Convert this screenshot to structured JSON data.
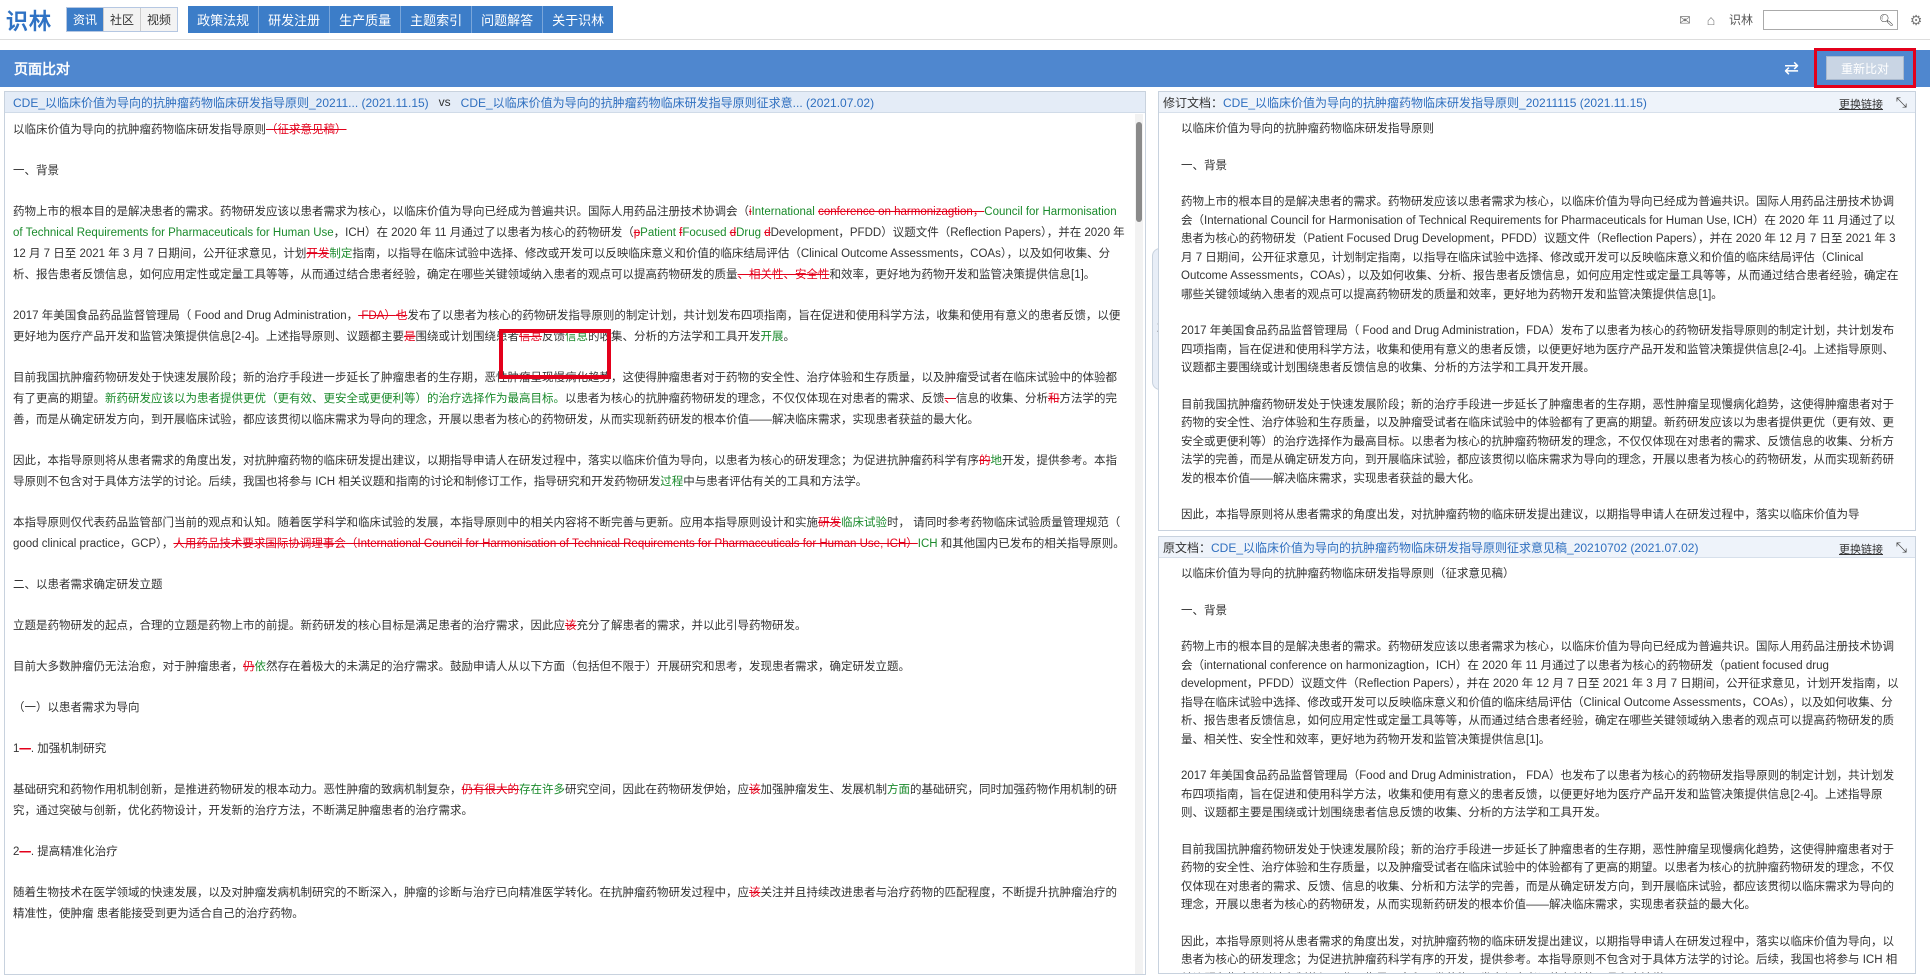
{
  "app": {
    "logo": "识林",
    "segments": [
      "资讯",
      "社区",
      "视频"
    ],
    "nav": [
      "政策法规",
      "研发注册",
      "生产质量",
      "主题索引",
      "问题解答",
      "关于识林"
    ],
    "icons": [
      "mail-icon",
      "home-icon",
      "settings-icon"
    ],
    "user_label": "识林",
    "search_placeholder": ""
  },
  "titlebar": {
    "title": "页面比对",
    "redo_label": "重新比对"
  },
  "left": {
    "header_a": "CDE_以临床价值为导向的抗肿瘤药物临床研发指导原则_20211... (2021.11.15)",
    "vs": "vs",
    "header_b": "CDE_以临床价值为导向的抗肿瘤药物临床研发指导原则征求意... (2021.07.02)",
    "p1": "以临床价值为导向的抗肿瘤药物临床研发指导原则",
    "p1_del": "（征求意见稿）",
    "p2": "一、背景",
    "p3a": "药物上市的根本目的是解决患者的需求。药物研发应该以患者需求为核心，以临床价值为导向已经成为普遍共识。国际人用药品注册技术协调会（",
    "p3b": "i",
    "p3c": "International ",
    "p3d": "conference on harmonizagtion，",
    "p3e": "Council for Harmonisation of Technical Requirements for Pharmaceuticals for Human Use",
    "p3f": "，ICH）在 2020 年 11 月通过了以患者为核心的药物研发（",
    "p3g": "p",
    "p3h": "Patient ",
    "p3i": "f",
    "p3j": "Focused ",
    "p3k": "d",
    "p3l": "Drug ",
    "p3m": "d",
    "p3n": "Development，PFDD）议题文件（Reflection Papers），并在 2020 年 12 月 7 日至 2021 年 3 月 7 日期间，公开征求意见，计划",
    "p3o": "开发",
    "p3p": "制定",
    "p3q": "指南，以指导在临床试验中选择、修改或开发可以反映临床意义和价值的临床结局评估（Clinical Outcome Assessments，COAs），以及如何收集、分析、报告患者反馈信息，如何应用定性或定量工具等等，从而通过结合患者经验，确定在哪些关键领域纳入患者的观点可以提高药物研发的质量",
    "p3r": "、相关性、安全性",
    "p3s": "和效率，更好地为药物开发和监管决策提供信息[1]。",
    "p4a": "2017 年美国食品药品监督管理局（ Food and Drug Administration，",
    "p4b": " FDA）",
    "p4c": "也",
    "p4d": "发布了以患者为核心的药物研发指导原则的制定计划，共计划发布四项指南，旨在促进和使用科学方法，收集和使用有意义的患者反馈，以便更好地为医疗产品开发和监管决策提供信息[2-4]。上述指导原则、议题都主要",
    "p4e": "是",
    "p4f": "围绕或计划围绕患者",
    "p4g": "信息",
    "p4h": "反馈",
    "p4i": "信息",
    "p4j": "的收集、分析的方法学和工具开发",
    "p4k": "开展",
    "p4l": "。",
    "p5a": "目前我国抗肿瘤药物研发处于快速发展阶段；新的治疗手段进一步延长了肿瘤患者的生存期，恶性肿瘤呈现慢病化趋势，这使得肿瘤患者对于药物的安全性、治疗体验和生存质量，以及肿瘤受试者在临床试验中的体验都有了更高的期望。",
    "p5b": "新药研发应该以为患者提供更优（更有效、更安全或更便利等）的治疗选择作为最高目标。",
    "p5c": "以患者为核心的抗肿瘤药物研发的理念，不仅仅体现在对患者的需求、反馈",
    "p5d": "、",
    "p5e": "信息的收集、分析",
    "p5f": "和",
    "p5g": "方法学的完善，而是从确定研发方向，到开展临床试验，都应该贯彻以临床需求为导向的理念，开展以患者为核心的药物研发，从而实现新药研发的根本价值——解决临床需求，实现患者获益的最大化。",
    "p6a": "因此，本指导原则将从患者需求的角度出发，对抗肿瘤药物的临床研发提出建议，以期指导申请人在研发过程中，落实以临床价值为导向，以患者为核心的研发理念；为促进抗肿瘤药科学有序",
    "p6b": "的",
    "p6c": "地",
    "p6d": "开发，提供参考。本指导原则不包含对于具体方法学的讨论。后续，我国也将参与 ICH 相关议题和指南的讨论和制修订工作，指导研究和开发药物研发",
    "p6e": "过程",
    "p6f": "中与患者评估有关的工具和方法学。",
    "p7a": "本指导原则仅代表药品监管部门当前的观点和认知。随着医学科学和临床试验的发展，本指导原则中的相关内容将不断完善与更新。应用本指导原则设计和实施",
    "p7b": "研发",
    "p7c": "临床试验",
    "p7d": "时， 请同时参考药物临床试验质量管理规范（ good clinical practice，GCP），",
    "p7e": "人用药品技术要求国际协调理事会（International Council for Harmonisation of Technical Requirements for Pharmaceuticals for Human Use, ICH）",
    "p7f": "ICH",
    "p7g": " 和其他国内已发布的相关指导原则。",
    "p8": "二、以患者需求确定研发立题",
    "p9a": "立题是药物研发的起点，合理的立题是药物上市的前提。新药研发的核心目标是满足患者的治疗需求，因此应",
    "p9b": "该",
    "p9c": "充分了解患者的需求，并以此引导药物研发。",
    "p10a": "目前大多数肿瘤仍无法治愈，对于肿瘤患者，",
    "p10b": "仍",
    "p10c": "依",
    "p10d": "然存在着极大的未满足的治疗需求。鼓励申请人从以下方面（包括但不限于）开展研究和思考，发现患者需求，确定研发立题。",
    "p11": "（一）以患者需求为导向",
    "p12a": "1",
    "p12b": "—",
    "p12c": ". 加强机制研究",
    "p13a": "基础研究和药物作用机制创新，是推进药物研发的根本动力。恶性肿瘤的致病机制复杂，",
    "p13b": "仍有很大的",
    "p13c": "存在许多",
    "p13d": "研究空间，因此在药物研发伊始，应",
    "p13e": "该",
    "p13f": "加强肿瘤发生、发展机制",
    "p13g": "方面",
    "p13h": "的基础研究，同时加强药物作用机制的研究，通过突破与创新，优化药物设计，开发新的治疗方法，不断满足肿瘤患者的治疗需求。",
    "p14a": "2",
    "p14b": "—",
    "p14c": ". 提高精准化治疗",
    "p15a": "随着生物技术在医学领域的快速发展，以及对肿瘤发病机制研究的不断深入，肿瘤的诊断与治疗已向精准医学转化。在抗肿瘤药物研发过程中，应",
    "p15b": "该",
    "p15c": "关注并且持续改进患者与治疗药物的匹配程度，不断提升抗肿瘤治疗的精准性，使肿瘤 患者能接受到更为适合自己的治疗药物。"
  },
  "collapse_label": "收起",
  "right_top": {
    "label": "修订文档：",
    "doc": "CDE_以临床价值为导向的抗肿瘤药物临床研发指导原则_20211115 (2021.11.15)",
    "change_link": "更换链接",
    "paras": [
      "以临床价值为导向的抗肿瘤药物临床研发指导原则",
      "一、背景",
      "药物上市的根本目的是解决患者的需求。药物研发应该以患者需求为核心，以临床价值为导向已经成为普遍共识。国际人用药品注册技术协调会（International Council for Harmonisation of Technical Requirements for Pharmaceuticals for Human Use, ICH）在 2020 年 11 月通过了以患者为核心的药物研发（Patient Focused Drug Development，PFDD）议题文件（Reflection Papers），并在 2020 年 12 月 7 日至 2021 年 3 月 7 日期间，公开征求意见，计划制定指南，以指导在临床试验中选择、修改或开发可以反映临床意义和价值的临床结局评估（Clinical Outcome Assessments，COAs），以及如何收集、分析、报告患者反馈信息，如何应用定性或定量工具等等，从而通过结合患者经验，确定在哪些关键领域纳入患者的观点可以提高药物研发的质量和效率，更好地为药物开发和监管决策提供信息[1]。",
      "2017 年美国食品药品监督管理局（ Food and Drug Administration，FDA）发布了以患者为核心的药物研发指导原则的制定计划，共计划发布四项指南，旨在促进和使用科学方法，收集和使用有意义的患者反馈，以便更好地为医疗产品开发和监管决策提供信息[2-4]。上述指导原则、议题都主要围绕或计划围绕患者反馈信息的收集、分析的方法学和工具开发开展。",
      "目前我国抗肿瘤药物研发处于快速发展阶段；新的治疗手段进一步延长了肿瘤患者的生存期，恶性肿瘤呈现慢病化趋势，这使得肿瘤患者对于药物的安全性、治疗体验和生存质量，以及肿瘤受试者在临床试验中的体验都有了更高的期望。新药研发应该以为患者提供更优（更有效、更安全或更便利等）的治疗选择作为最高目标。以患者为核心的抗肿瘤药物研发的理念，不仅仅体现在对患者的需求、反馈信息的收集、分析方法学的完善，而是从确定研发方向，到开展临床试验，都应该贯彻以临床需求为导向的理念，开展以患者为核心的药物研发，从而实现新药研发的根本价值——解决临床需求，实现患者获益的最大化。",
      "因此，本指导原则将从患者需求的角度出发，对抗肿瘤药物的临床研发提出建议，以期指导申请人在研发过程中，落实以临床价值为导"
    ]
  },
  "right_bottom": {
    "label": "原文档：",
    "doc": "CDE_以临床价值为导向的抗肿瘤药物临床研发指导原则征求意见稿_20210702 (2021.07.02)",
    "change_link": "更换链接",
    "paras": [
      "以临床价值为导向的抗肿瘤药物临床研发指导原则（征求意见稿）",
      "一、背景",
      "药物上市的根本目的是解决患者的需求。药物研发应该以患者需求为核心，以临床价值为导向已经成为普遍共识。国际人用药品注册技术协调会（international conference on harmonizagtion，ICH）在 2020 年 11 月通过了以患者为核心的药物研发（patient focused drug development，PFDD）议题文件（Reflection Papers），并在 2020 年 12 月 7 日至 2021 年 3 月 7 日期间，公开征求意见，计划开发指南，以指导在临床试验中选择、修改或开发可以反映临床意义和价值的临床结局评估（Clinical Outcome Assessments，COAs），以及如何收集、分析、报告患者反馈信息，如何应用定性或定量工具等等，从而通过结合患者经验，确定在哪些关键领域纳入患者的观点可以提高药物研发的质量、相关性、安全性和效率，更好地为药物开发和监管决策提供信息[1]。",
      "2017 年美国食品药品监督管理局（Food and Drug Administration， FDA）也发布了以患者为核心的药物研发指导原则的制定计划，共计划发布四项指南，旨在促进和使用科学方法，收集和使用有意义的患者反馈，以便更好地为医疗产品开发和监管决策提供信息[2-4]。上述指导原则、议题都主要是围绕或计划围绕患者信息反馈的收集、分析的方法学和工具开发。",
      "目前我国抗肿瘤药物研发处于快速发展阶段；新的治疗手段进一步延长了肿瘤患者的生存期，恶性肿瘤呈现慢病化趋势，这使得肿瘤患者对于药物的安全性、治疗体验和生存质量，以及肿瘤受试者在临床试验中的体验都有了更高的期望。以患者为核心的抗肿瘤药物研发的理念，不仅仅体现在对患者的需求、反馈、信息的收集、分析和方法学的完善，而是从确定研发方向，到开展临床试验，都应该贯彻以临床需求为导向的理念，开展以患者为核心的药物研发，从而实现新药研发的根本价值——解决临床需求，实现患者获益的最大化。",
      "因此，本指导原则将从患者需求的角度出发，对抗肿瘤药物的临床研发提出建议，以期指导申请人在研发过程中，落实以临床价值为导向，以患者为核心的研发理念；为促进抗肿瘤药科学有序的开发，提供参考。本指导原则不包含对于具体方法学的讨论。后续，我国也将参与 ICH 相关议题和指南的讨论和制修订工作，指导研究和开发药物研发中与患者评估有关的工具和方法学。"
    ]
  }
}
